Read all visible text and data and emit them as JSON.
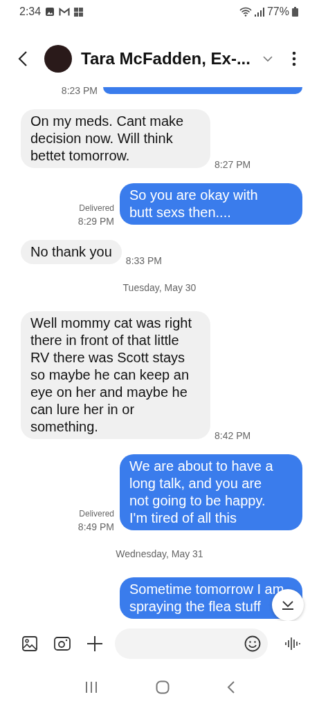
{
  "status_bar": {
    "time": "2:34",
    "battery": "77%"
  },
  "header": {
    "title": "Tara McFadden, Ex-..."
  },
  "messages": [
    {
      "kind": "sent_partial",
      "time": "8:23 PM"
    },
    {
      "kind": "received",
      "text": "On my meds. Cant make decision now. Will think bettet tomorrow.",
      "time": "8:27 PM"
    },
    {
      "kind": "sent",
      "text": "So you are okay with butt sexs then....",
      "status": "Delivered",
      "time": "8:29 PM"
    },
    {
      "kind": "received",
      "text": "No thank you",
      "time": "8:33 PM"
    },
    {
      "kind": "date",
      "text": "Tuesday, May 30"
    },
    {
      "kind": "received",
      "text": "Well mommy cat was right there in front of that little RV there was Scott stays so maybe he can keep an eye on her and maybe he can lure her in or something.",
      "time": "8:42 PM"
    },
    {
      "kind": "sent",
      "text": "We are about to have a long talk, and you are not going to be happy.  I'm tired of all this",
      "status": "Delivered",
      "time": "8:49 PM"
    },
    {
      "kind": "date",
      "text": "Wednesday, May 31"
    },
    {
      "kind": "sent",
      "text": "Sometime tomorrow I am spraying the flea stuff"
    }
  ]
}
